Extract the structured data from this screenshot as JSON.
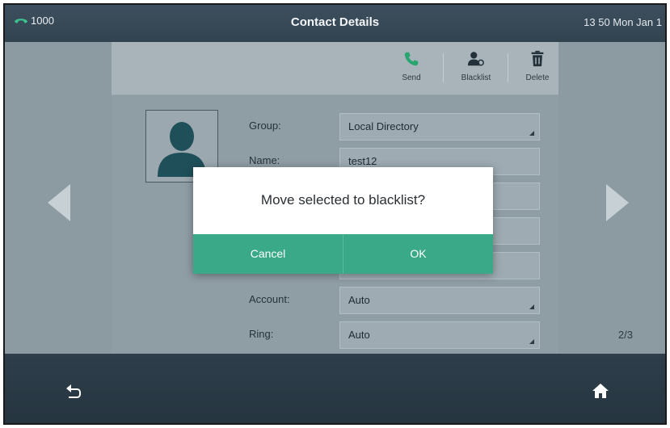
{
  "statusbar": {
    "line_label": "1000",
    "title": "Contact Details",
    "clock": "13 50 Mon Jan 1"
  },
  "toolbar": {
    "send_label": "Send",
    "blacklist_label": "Blacklist",
    "delete_label": "Delete"
  },
  "form": {
    "rows": [
      {
        "label": "Group:",
        "value": "Local Directory"
      },
      {
        "label": "Name:",
        "value": "test12"
      },
      {
        "label": "Account:",
        "value": "Auto"
      },
      {
        "label": "Ring:",
        "value": "Auto"
      }
    ]
  },
  "pager": "2/3",
  "dialog": {
    "message": "Move selected to blacklist?",
    "cancel_label": "Cancel",
    "ok_label": "OK"
  },
  "colors": {
    "accent": "#3aa987",
    "line_icon": "#3cc28f"
  },
  "icons": {
    "line": "phone-line-icon",
    "send": "phone-icon",
    "blacklist": "person-block-icon",
    "delete": "trash-icon",
    "back": "back-arrow-icon",
    "home": "home-icon"
  }
}
